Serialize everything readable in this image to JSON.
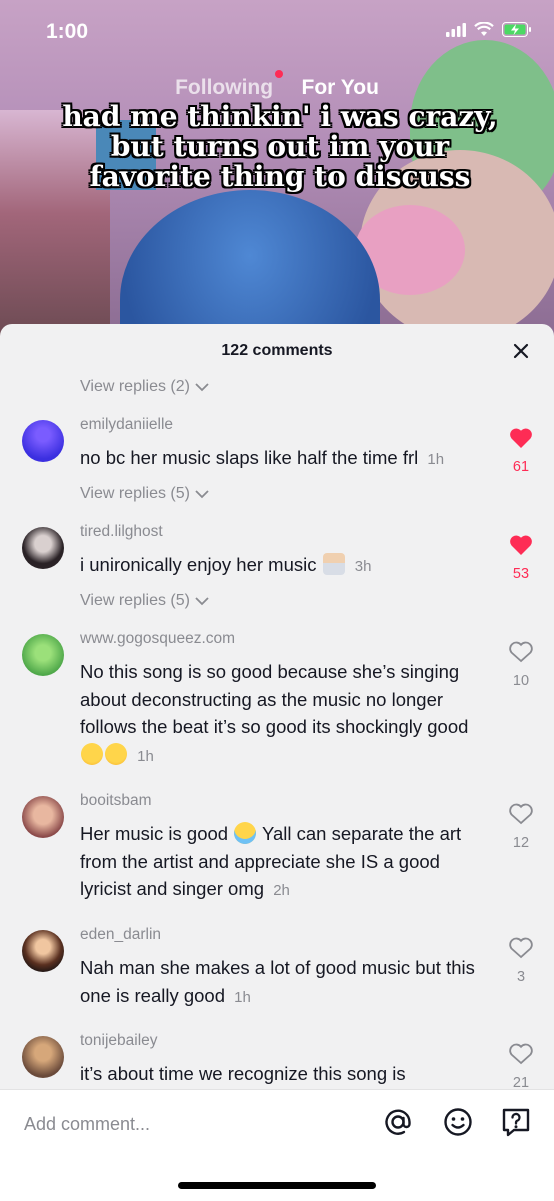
{
  "status": {
    "time": "1:00"
  },
  "feed_tabs": {
    "following": "Following",
    "for_you": "For You"
  },
  "caption": "had me thinkin' i was crazy, but turns out im your favorite thing to discuss",
  "sheet": {
    "title": "122 comments"
  },
  "replies_toggles": [
    "View replies (2)",
    "View replies (5)",
    "View replies (5)"
  ],
  "comments": [
    {
      "username": "emilydaniielle",
      "text": "no bc her music slaps like half the time frl",
      "time": "1h",
      "likes": "61",
      "liked": true
    },
    {
      "username": "tired.lilghost",
      "text": "i unironically enjoy her music",
      "emoji": "man-shrugging",
      "time": "3h",
      "likes": "53",
      "liked": true
    },
    {
      "username": "www.gogosqueez.com",
      "text": "No this song is so good because she’s singing about deconstructing as the music no longer follows the beat it’s so good its shockingly good",
      "emoji": "flushed-face x2",
      "time": "1h",
      "likes": "10",
      "liked": false
    },
    {
      "username": "booitsbam",
      "text_before": "Her music is good",
      "emoji": "face-with-tears-of-joy",
      "text_after": "Yall can separate the art from the artist and appreciate she IS a good lyricist and singer omg",
      "time": "2h",
      "likes": "12",
      "liked": false
    },
    {
      "username": "eden_darlin",
      "text": "Nah man she makes a lot of good music but this one is really good",
      "time": "1h",
      "likes": "3",
      "liked": false
    },
    {
      "username": "tonijebailey",
      "text": "it’s about time we recognize this song is",
      "likes": "21",
      "liked": false
    }
  ],
  "input": {
    "placeholder": "Add comment..."
  },
  "colors": {
    "like_red": "#fe2c55",
    "muted": "#8a8b91",
    "text": "#161823",
    "sheet_bg": "#f1f1f2"
  },
  "icons": [
    "close-icon",
    "chevron-down-icon",
    "heart-icon",
    "at-mention-icon",
    "emoji-icon",
    "question-icon",
    "signal-icon",
    "wifi-icon",
    "battery-charging-icon"
  ]
}
